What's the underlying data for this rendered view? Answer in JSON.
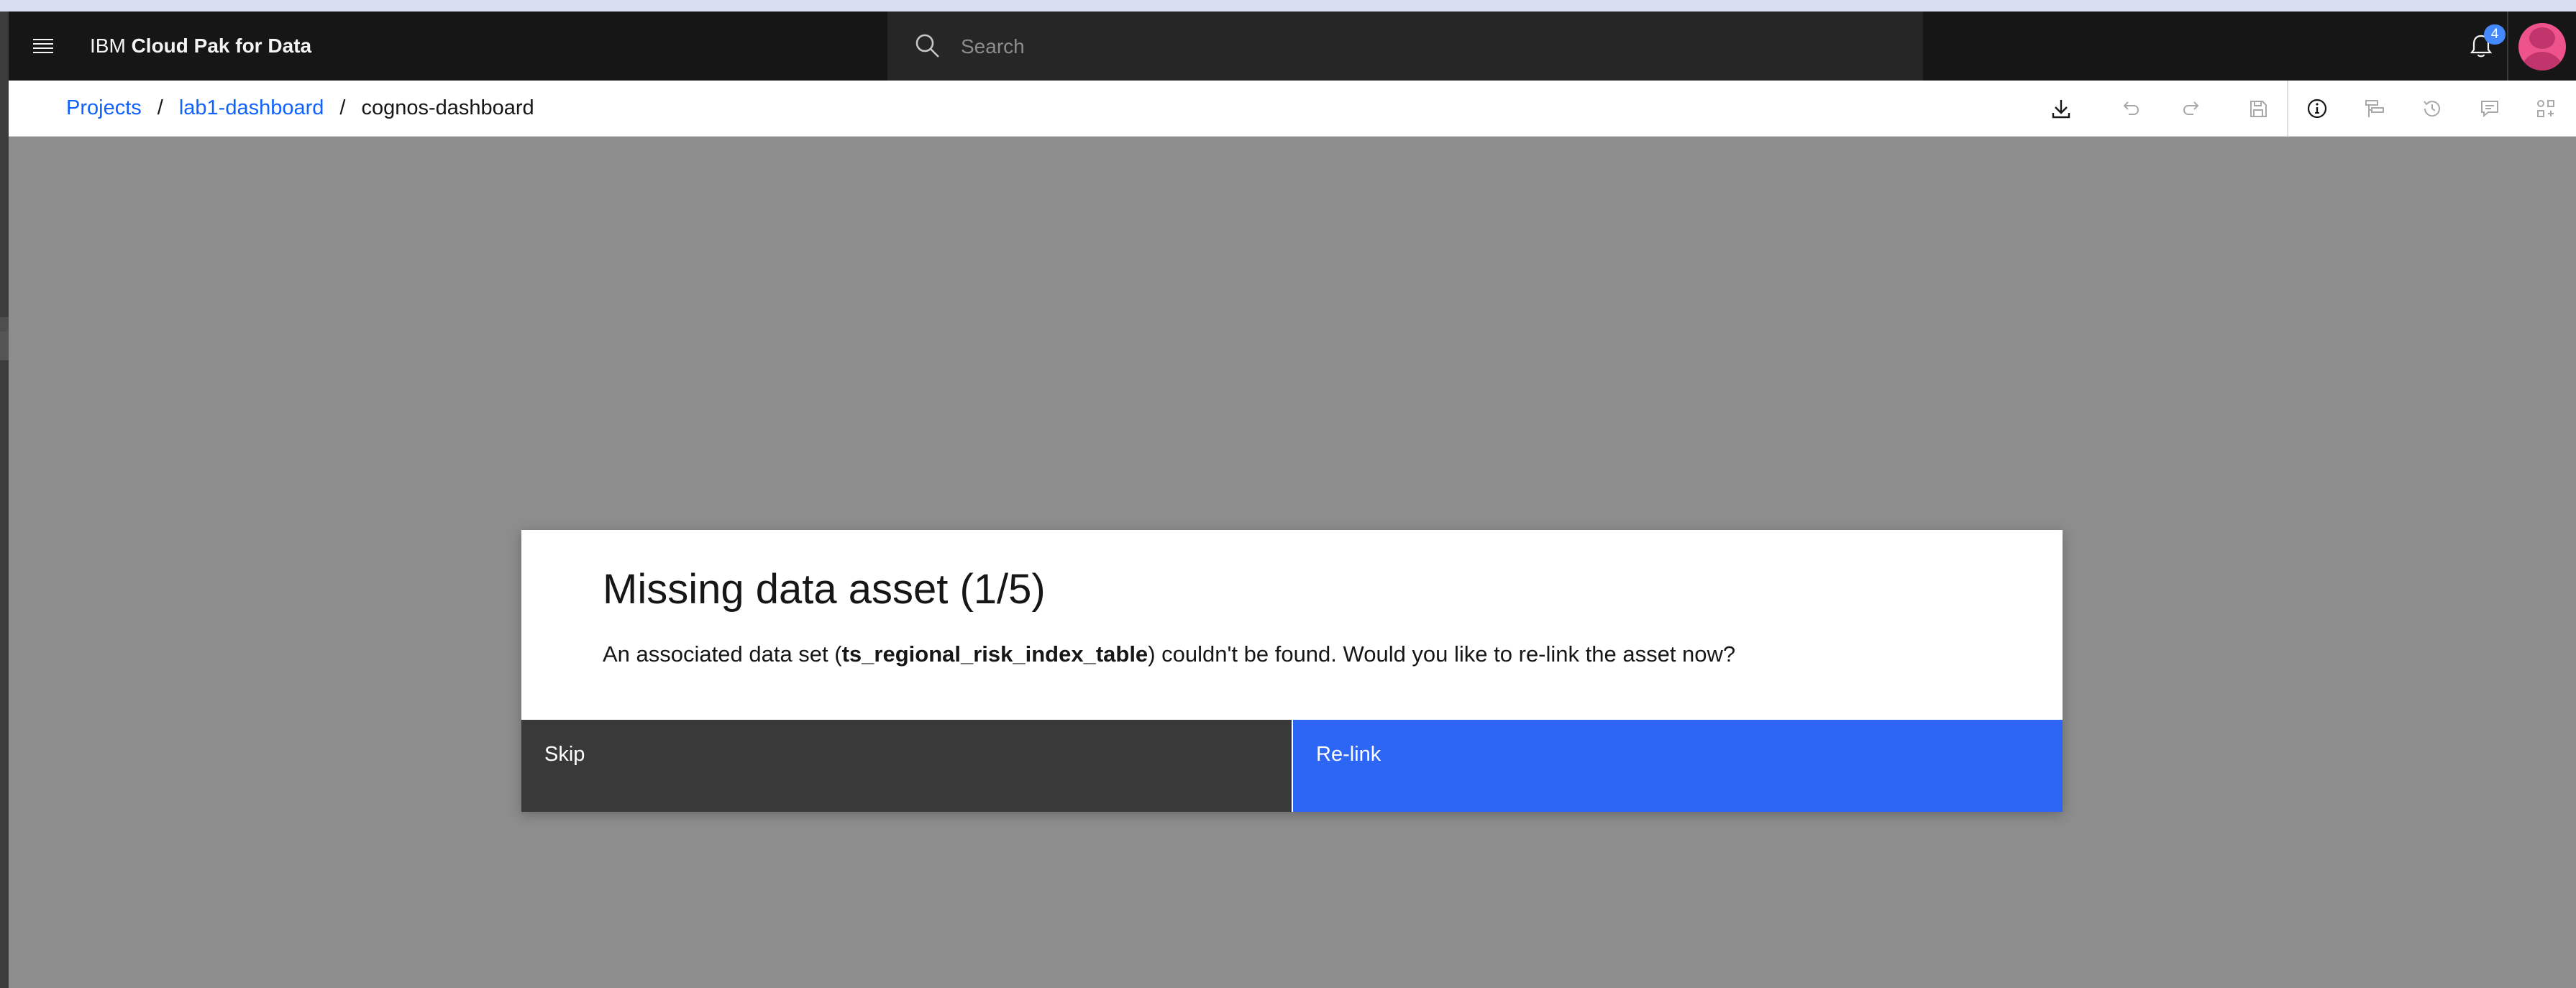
{
  "header": {
    "menu_icon": "hamburger-menu-icon",
    "brand": "IBM",
    "product": "Cloud Pak for Data",
    "search": {
      "placeholder": "Search",
      "value": ""
    },
    "notifications": {
      "icon": "bell-icon",
      "count": "4"
    },
    "avatar_icon": "user-avatar"
  },
  "breadcrumb": {
    "items": [
      "Projects",
      "lab1-dashboard"
    ],
    "current": "cognos-dashboard",
    "separator": "/"
  },
  "toolbar": {
    "icons": [
      "download-icon",
      "undo-icon",
      "redo-icon",
      "save-icon",
      "info-icon",
      "data-sources-icon",
      "history-icon",
      "comment-icon",
      "widgets-icon"
    ]
  },
  "modal": {
    "title": "Missing data asset (1/5)",
    "message_before": "An associated data set (",
    "asset_name": "ts_regional_risk_index_table",
    "message_after": ") couldn't be found. Would you like to re-link the asset now?",
    "skip_label": "Skip",
    "relink_label": "Re-link"
  },
  "colors": {
    "header_bg": "#161616",
    "link": "#0f62fe",
    "overlay": "#8d8d8d",
    "primary_button": "#2d66f5",
    "secondary_button": "#393939",
    "notification_badge": "#4589ff",
    "avatar": "#ee538b"
  }
}
